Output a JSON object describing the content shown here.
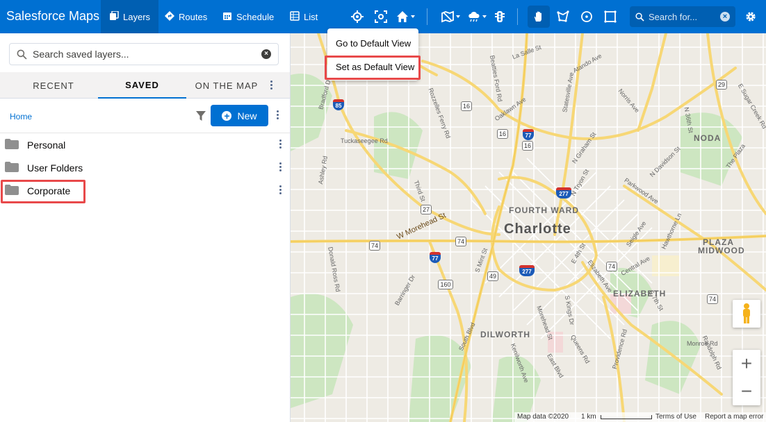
{
  "header": {
    "brand": "Salesforce Maps",
    "tabs": [
      {
        "label": "Layers",
        "icon": "layers-icon"
      },
      {
        "label": "Routes",
        "icon": "routes-icon"
      },
      {
        "label": "Schedule",
        "icon": "calendar-icon"
      },
      {
        "label": "List",
        "icon": "list-icon"
      }
    ],
    "search_placeholder": "Search for..."
  },
  "home_menu": {
    "items": [
      "Go to Default View",
      "Set as Default View"
    ],
    "highlighted_item": "Set as Default View"
  },
  "panel": {
    "search_placeholder": "Search saved layers...",
    "tabs": [
      "RECENT",
      "SAVED",
      "ON THE MAP"
    ],
    "active_tab": "SAVED",
    "breadcrumb": "Home",
    "new_button": "New",
    "folders": [
      "Personal",
      "User Folders",
      "Corporate"
    ],
    "highlighted_folder": "Corporate"
  },
  "map": {
    "city": "Charlotte",
    "areas": [
      "FOURTH WARD",
      "ELIZABETH",
      "DILWORTH",
      "NODA",
      "PLAZA",
      "MIDWOOD"
    ],
    "streets": [
      "W Morehead St",
      "La Salle St",
      "Tuckaseegee Rd",
      "Central Ave",
      "Providence Rd",
      "Monroe Rd",
      "Queens Rd",
      "Kenilworth Ave",
      "S Mint St",
      "Beatties Ford Rd",
      "Rozzelles Ferry Rd",
      "Oaklawn Ave",
      "Statesville Ave",
      "Atando Ave",
      "Bradford Dr",
      "Ashley Rd",
      "Donald Ross Rd",
      "Barringer Dr",
      "South Blvd",
      "E 4th St",
      "E 7th St",
      "N Tryon St",
      "Parkwood Ave",
      "Hawthorne Ln",
      "Randolph Rd",
      "Norris Ave",
      "N Davidson St",
      "The Plaza",
      "E Sugar Creek Rd",
      "N Graham St",
      "Elizabeth Ave",
      "Seigle Ave",
      "Morehead St",
      "Third St",
      "East Blvd",
      "N 36th St",
      "S Kings Dr"
    ],
    "route_shields": [
      "29",
      "16",
      "16",
      "16",
      "27",
      "74",
      "74",
      "74",
      "74",
      "49",
      "160"
    ],
    "interstate_shields": [
      "85",
      "77",
      "277",
      "77",
      "277"
    ],
    "attribution": {
      "map_data": "Map data ©2020",
      "scale": "1 km",
      "terms": "Terms of Use",
      "report": "Report a map error"
    }
  },
  "colors": {
    "brand_blue": "#0070d2",
    "header_active": "#005fb2",
    "highlight_red": "#e8494a",
    "highway_yellow": "#f7d775",
    "park_green": "#cde6c1"
  }
}
